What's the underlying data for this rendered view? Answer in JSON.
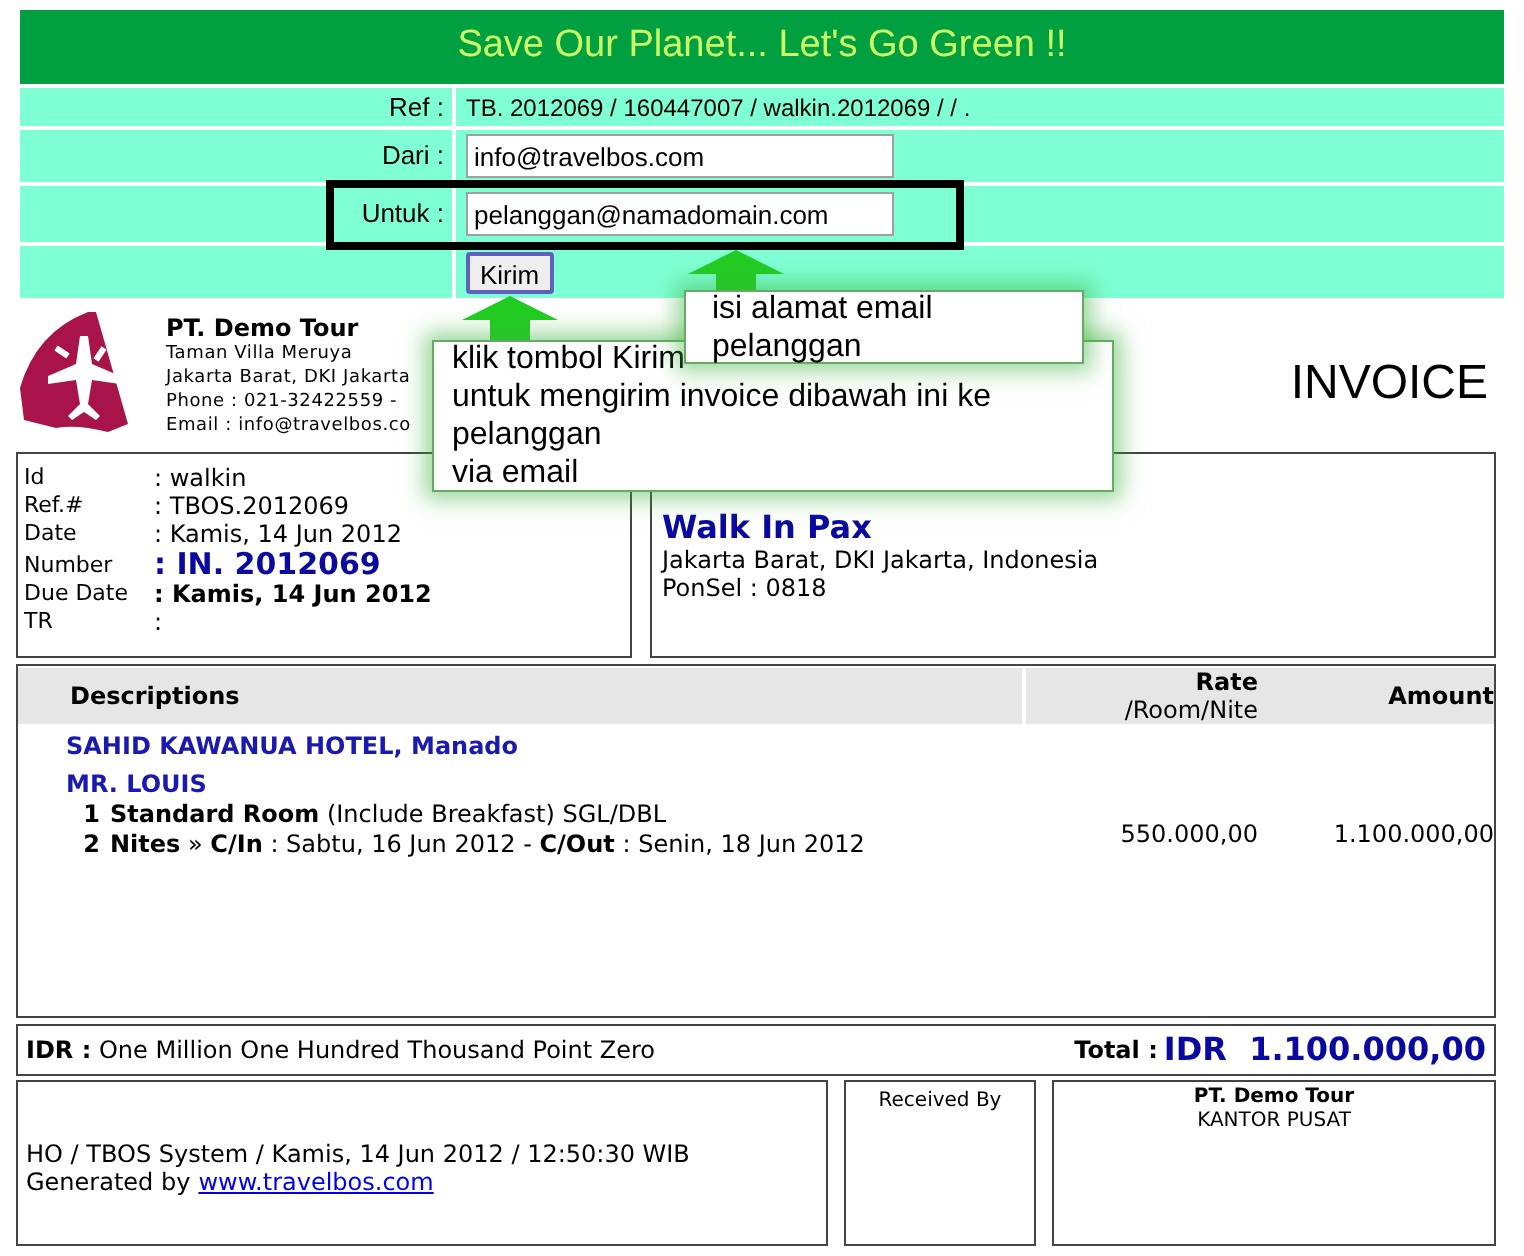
{
  "banner": {
    "title": "Save Our Planet... Let's Go Green !!"
  },
  "email_form": {
    "ref_label": "Ref :",
    "ref_value": "TB. 2012069 / 160447007 / walkin.2012069 / / .",
    "from_label": "Dari :",
    "from_value": "info@travelbos.com",
    "to_label": "Untuk :",
    "to_value": "pelanggan@namadomain.com",
    "send_button": "Kirim"
  },
  "callouts": [
    {
      "text": "isi alamat email pelanggan"
    },
    {
      "text": "klik tombol Kirim\nuntuk mengirim invoice dibawah ini ke pelanggan\nvia email"
    }
  ],
  "company": {
    "name": "PT. Demo Tour",
    "lines": [
      "Taman Villa Meruya",
      "Jakarta Barat, DKI Jakarta",
      "Phone : 021-32422559 -",
      "Email : info@travelbos.co"
    ]
  },
  "doc_title": "INVOICE",
  "details": [
    {
      "label": "Id",
      "value": ": walkin",
      "kind": "plain"
    },
    {
      "label": "Ref.#",
      "value": ": TBOS.2012069",
      "kind": "plain"
    },
    {
      "label": "Date",
      "value": ": Kamis, 14 Jun 2012",
      "kind": "plain"
    },
    {
      "label": "Number",
      "value": ": IN. 2012069",
      "kind": "number"
    },
    {
      "label": "Due Date",
      "value": ": Kamis, 14 Jun 2012",
      "kind": "bold"
    },
    {
      "label": "TR",
      "value": ":",
      "kind": "plain"
    }
  ],
  "customer": {
    "name": "Walk In Pax",
    "lines": [
      "Jakarta Barat, DKI Jakarta, Indonesia",
      "PonSel : 0818"
    ]
  },
  "table": {
    "columns": [
      {
        "label": "Descriptions"
      },
      {
        "label": "Rate",
        "sublabel": "/Room/Nite"
      },
      {
        "label": "Amount"
      }
    ],
    "hotel": "SAHID KAWANUA HOTEL, Manado",
    "guest": "MR. LOUIS",
    "lines": [
      {
        "qty": "1",
        "text": "**Standard Room** (Include Breakfast) SGL/DBL"
      },
      {
        "qty": "2",
        "text": "**Nites** » **C/In** : Sabtu, 16 Jun 2012 - **C/Out** : Senin, 18 Jun 2012"
      }
    ],
    "rate": "550.000,00",
    "amount": "1.100.000,00"
  },
  "total": {
    "words": "**IDR :** One Million One Hundred Thousand Point Zero",
    "label": "Total :",
    "value": "IDR  1.100.000,00"
  },
  "footer": {
    "system_line": "HO / TBOS System / Kamis, 14 Jun 2012 / 12:50:30 WIB",
    "generated_label": "Generated by",
    "link": "www.travelbos.com",
    "received_label": "Received By",
    "signer": "PT. Demo Tour",
    "office": "KANTOR PUSAT"
  }
}
